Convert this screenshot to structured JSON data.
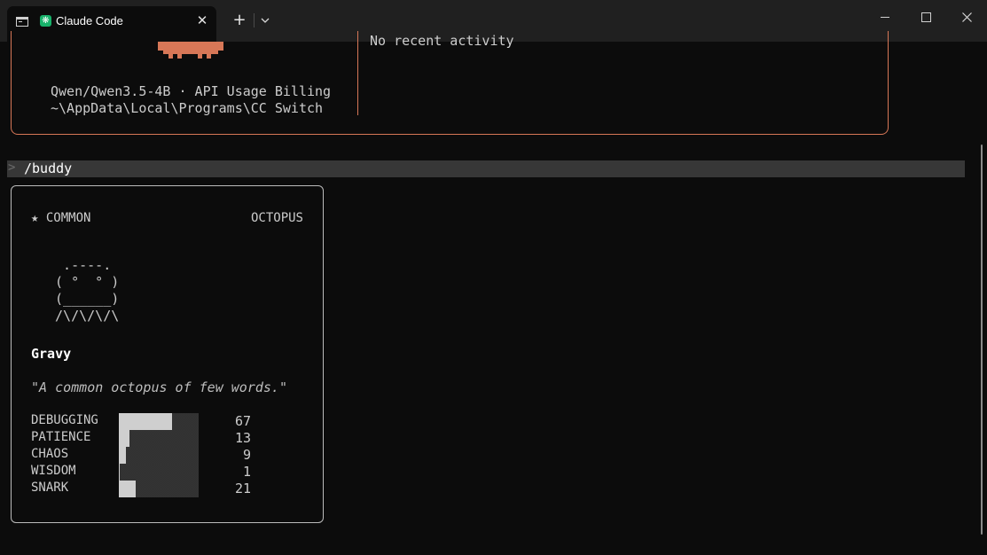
{
  "window": {
    "tab_title": "Claude Code",
    "app_icon_glyph": "❋",
    "close_tab": "✕",
    "new_tab": "+",
    "accent_color": "#d77757"
  },
  "welcome": {
    "model_line": "Qwen/Qwen3.5-4B · API Usage Billing",
    "cwd_line": "~\\AppData\\Local\\Programs\\CC Switch",
    "activity_text": "No recent activity"
  },
  "prompt": {
    "char": ">",
    "command": "/buddy"
  },
  "buddy": {
    "rarity": "★ COMMON",
    "species": "OCTOPUS",
    "ascii_art": "  .----.\n ( °  ° )\n (______)\n /\\/\\/\\/\\",
    "name": "Gravy",
    "quote": "\"A common octopus of few words.\"",
    "stats": [
      {
        "label": "DEBUGGING",
        "value": "67"
      },
      {
        "label": "PATIENCE",
        "value": "13"
      },
      {
        "label": "CHAOS",
        "value": "9"
      },
      {
        "label": "WISDOM",
        "value": "1"
      },
      {
        "label": "SNARK",
        "value": "21"
      }
    ]
  }
}
